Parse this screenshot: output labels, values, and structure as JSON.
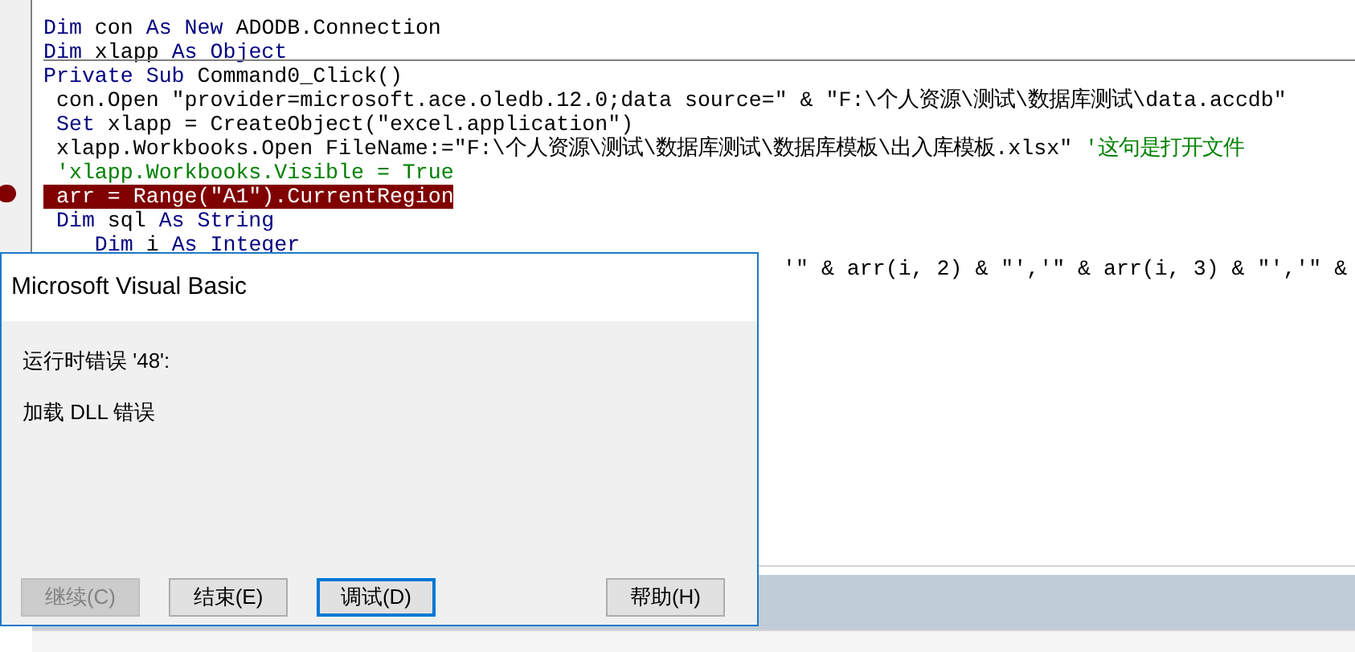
{
  "code": {
    "lines": [
      {
        "breakpoint": false,
        "separator_after": false,
        "segments": [
          {
            "kind": "keyword",
            "text": "Dim"
          },
          {
            "kind": "plain",
            "text": " con "
          },
          {
            "kind": "keyword",
            "text": "As New"
          },
          {
            "kind": "plain",
            "text": " ADODB.Connection"
          }
        ]
      },
      {
        "breakpoint": false,
        "separator_after": true,
        "segments": [
          {
            "kind": "keyword",
            "text": "Dim"
          },
          {
            "kind": "plain",
            "text": " xlapp "
          },
          {
            "kind": "keyword",
            "text": "As Object"
          }
        ]
      },
      {
        "breakpoint": false,
        "separator_after": false,
        "segments": [
          {
            "kind": "keyword",
            "text": "Private Sub"
          },
          {
            "kind": "plain",
            "text": " Command0_Click()"
          }
        ]
      },
      {
        "breakpoint": false,
        "separator_after": false,
        "segments": [
          {
            "kind": "plain",
            "text": " con.Open \"provider=microsoft.ace.oledb.12.0;data source=\" & \"F:\\个人资源\\测试\\数据库测试\\data.accdb\""
          }
        ]
      },
      {
        "breakpoint": false,
        "separator_after": false,
        "segments": [
          {
            "kind": "keyword",
            "text": " Set"
          },
          {
            "kind": "plain",
            "text": " xlapp = CreateObject(\"excel.application\")"
          }
        ]
      },
      {
        "breakpoint": false,
        "separator_after": false,
        "segments": [
          {
            "kind": "plain",
            "text": " xlapp.Workbooks.Open FileName:=\"F:\\个人资源\\测试\\数据库测试\\数据库模板\\出入库模板.xlsx\" "
          },
          {
            "kind": "comment",
            "text": "'这句是打开文件"
          }
        ]
      },
      {
        "breakpoint": false,
        "separator_after": false,
        "segments": [
          {
            "kind": "comment",
            "text": " 'xlapp.Workbooks.Visible = True"
          }
        ]
      },
      {
        "breakpoint": true,
        "separator_after": false,
        "segments": [
          {
            "kind": "plain",
            "text": " arr = Range(\"A1\").CurrentRegion"
          }
        ]
      },
      {
        "breakpoint": false,
        "separator_after": false,
        "segments": [
          {
            "kind": "keyword",
            "text": " Dim"
          },
          {
            "kind": "plain",
            "text": " sql "
          },
          {
            "kind": "keyword",
            "text": "As String"
          }
        ]
      },
      {
        "breakpoint": false,
        "segments": [
          {
            "kind": "keyword",
            "text": "    Dim"
          },
          {
            "kind": "plain",
            "text": " i "
          },
          {
            "kind": "keyword",
            "text": "As Integer"
          }
        ]
      }
    ],
    "visible_tail": "'\" & arr(i, 2) & \"','\" & arr(i, 3) & \"','\" &"
  },
  "dialog": {
    "title": "Microsoft Visual Basic",
    "messages": [
      "运行时错误 '48':",
      "加载 DLL 错误"
    ],
    "buttons": [
      {
        "label": "继续(C)",
        "disabled": true,
        "selected": false
      },
      {
        "label": "结束(E)",
        "disabled": false,
        "selected": false
      },
      {
        "label": "调试(D)",
        "disabled": false,
        "selected": true
      },
      {
        "label": "帮助(H)",
        "disabled": false,
        "selected": false
      }
    ]
  }
}
